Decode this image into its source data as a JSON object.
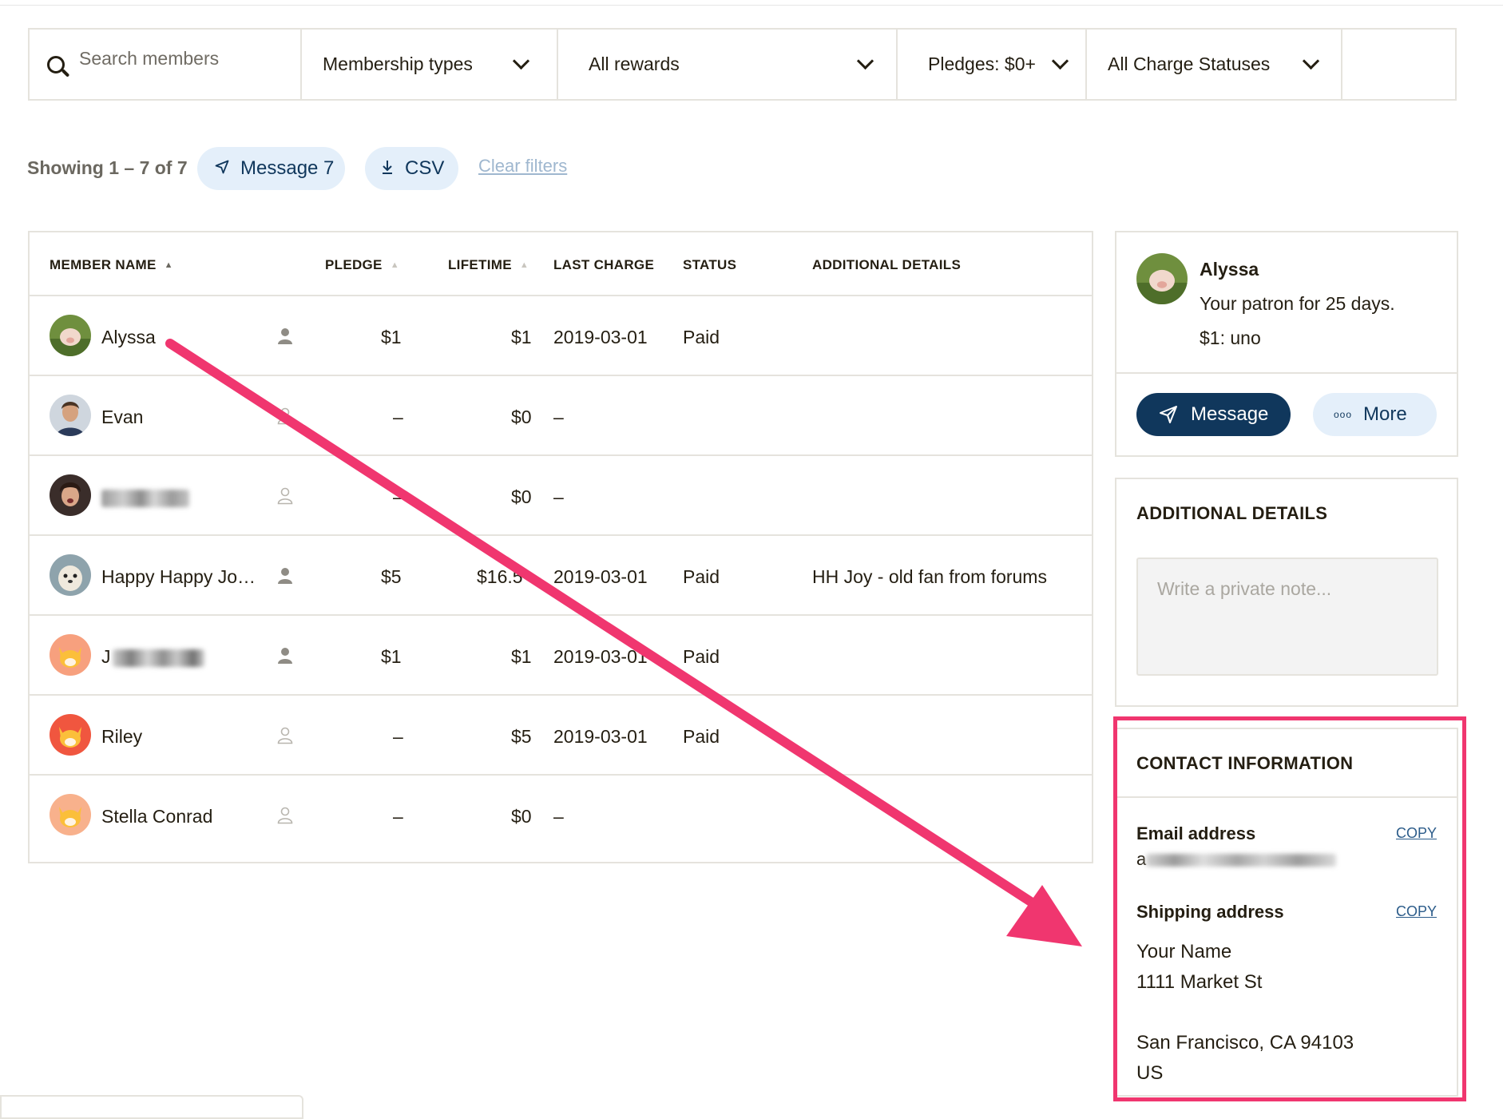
{
  "filters": {
    "search_placeholder": "Search members",
    "membership_types": "Membership types",
    "rewards": "All rewards",
    "pledges": "Pledges: $0+",
    "charge_statuses": "All Charge Statuses"
  },
  "summary": {
    "showing": "Showing 1 – 7 of 7",
    "message_button": "Message 7",
    "csv_button": "CSV",
    "clear_filters": "Clear filters"
  },
  "table": {
    "headers": {
      "member_name": "MEMBER NAME",
      "pledge": "PLEDGE",
      "lifetime": "LIFETIME",
      "last_charge": "LAST CHARGE",
      "status": "STATUS",
      "additional_details": "ADDITIONAL DETAILS"
    },
    "rows": [
      {
        "name": "Alyssa",
        "pledge": "$1",
        "lifetime": "$1",
        "last_charge": "2019-03-01",
        "status": "Paid",
        "details": ""
      },
      {
        "name": "Evan",
        "pledge": "–",
        "lifetime": "$0",
        "last_charge": "–",
        "status": "",
        "details": ""
      },
      {
        "name": "",
        "pledge": "–",
        "lifetime": "$0",
        "last_charge": "–",
        "status": "",
        "details": ""
      },
      {
        "name": "Happy Happy Jo…",
        "pledge": "$5",
        "lifetime": "$16.5",
        "last_charge": "2019-03-01",
        "status": "Paid",
        "details": "HH Joy - old fan from forums"
      },
      {
        "name": "J",
        "pledge": "$1",
        "lifetime": "$1",
        "last_charge": "2019-03-01",
        "status": "Paid",
        "details": ""
      },
      {
        "name": "Riley",
        "pledge": "–",
        "lifetime": "$5",
        "last_charge": "2019-03-01",
        "status": "Paid",
        "details": ""
      },
      {
        "name": "Stella Conrad",
        "pledge": "–",
        "lifetime": "$0",
        "last_charge": "–",
        "status": "",
        "details": ""
      }
    ]
  },
  "profile": {
    "name": "Alyssa",
    "patron_for": "Your patron for 25 days.",
    "tier": "$1: uno",
    "message_button": "Message",
    "more_button": "More"
  },
  "additional_details": {
    "title": "ADDITIONAL DETAILS",
    "note_placeholder": "Write a private note..."
  },
  "contact": {
    "title": "CONTACT INFORMATION",
    "email_label": "Email address",
    "email_prefix": "a",
    "copy_label": "COPY",
    "shipping_label": "Shipping address",
    "address_line1": "Your Name",
    "address_line2": "1111 Market St",
    "address_city": "San Francisco, CA 94103",
    "address_country": "US"
  },
  "colors": {
    "highlight": "#f0366f",
    "primary": "#10375c",
    "pill_bg": "#e4effa"
  }
}
